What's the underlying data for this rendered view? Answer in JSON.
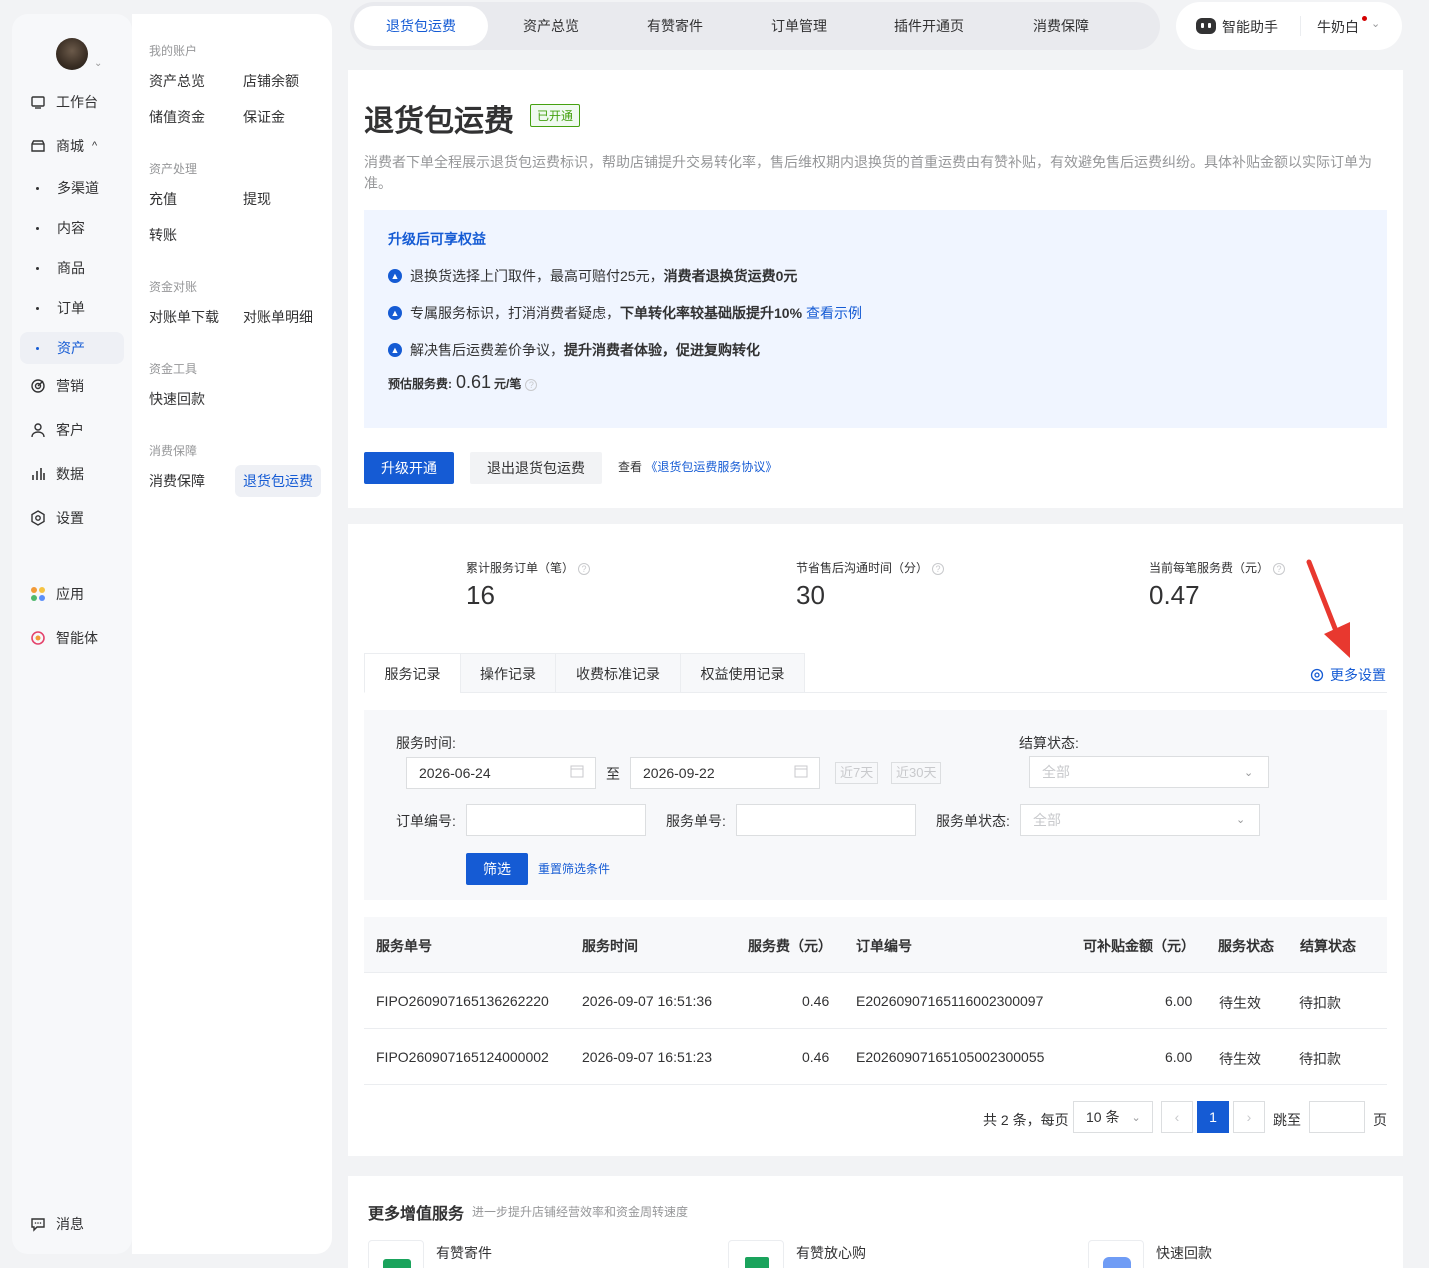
{
  "sidebar": {
    "main": [
      {
        "label": "工作台",
        "icon": "workbench-icon"
      },
      {
        "label": "商城",
        "icon": "store-icon",
        "chevron": "^"
      },
      {
        "label": "营销",
        "icon": "marketing-icon"
      },
      {
        "label": "客户",
        "icon": "customer-icon"
      },
      {
        "label": "数据",
        "icon": "data-icon"
      },
      {
        "label": "设置",
        "icon": "settings-icon"
      },
      {
        "label": "应用",
        "icon": "apps-icon"
      },
      {
        "label": "智能体",
        "icon": "agent-icon"
      }
    ],
    "mall_sub": [
      {
        "label": "多渠道"
      },
      {
        "label": "内容"
      },
      {
        "label": "商品"
      },
      {
        "label": "订单"
      },
      {
        "label": "资产",
        "active": true
      }
    ],
    "message": {
      "label": "消息",
      "icon": "message-icon"
    }
  },
  "subnav": {
    "groups": [
      {
        "title": "我的账户",
        "links": [
          "资产总览",
          "店铺余额",
          "储值资金",
          "保证金"
        ]
      },
      {
        "title": "资产处理",
        "links": [
          "充值",
          "提现",
          "转账"
        ]
      },
      {
        "title": "资金对账",
        "links": [
          "对账单下载",
          "对账单明细"
        ]
      },
      {
        "title": "资金工具",
        "links": [
          "快速回款"
        ]
      },
      {
        "title": "消费保障",
        "links": [
          "消费保障",
          "退货包运费"
        ]
      }
    ],
    "active_link": "退货包运费"
  },
  "topbar": {
    "tabs": [
      "退货包运费",
      "资产总览",
      "有赞寄件",
      "订单管理",
      "插件开通页",
      "消费保障"
    ],
    "active_tab": "退货包运费",
    "assistant": "智能助手",
    "user": "牛奶白"
  },
  "intro": {
    "title": "退货包运费",
    "status_badge": "已开通",
    "description": "消费者下单全程展示退货包运费标识，帮助店铺提升交易转化率，售后维权期内退换货的首重运费由有赞补贴，有效避免售后运费纠纷。具体补贴金额以实际订单为准。",
    "benefits_title": "升级后可享权益",
    "benefits": [
      {
        "text": "退换货选择上门取件，最高可赔付25元，",
        "bold": "消费者退换货运费0元",
        "link": ""
      },
      {
        "text": "专属服务标识，打消消费者疑虑，",
        "bold": "下单转化率较基础版提升10%",
        "link": "查看示例"
      },
      {
        "text": "解决售后运费差价争议，",
        "bold": "提升消费者体验，促进复购转化",
        "link": ""
      }
    ],
    "fee_label": "预估服务费:",
    "fee_value": "0.61",
    "fee_unit": "元/笔",
    "upgrade_button": "升级开通",
    "exit_button": "退出退货包运费",
    "agreement_prefix": "查看",
    "agreement_link": "《退货包运费服务协议》"
  },
  "stats": [
    {
      "label": "累计服务订单（笔）",
      "value": "16"
    },
    {
      "label": "节省售后沟通时间（分）",
      "value": "30"
    },
    {
      "label": "当前每笔服务费（元）",
      "value": "0.47"
    }
  ],
  "record_tabs": [
    "服务记录",
    "操作记录",
    "收费标准记录",
    "权益使用记录"
  ],
  "active_record_tab": "服务记录",
  "more_settings": "更多设置",
  "filter": {
    "service_time_label": "服务时间:",
    "start_date": "2026-06-24",
    "to_label": "至",
    "end_date": "2026-09-22",
    "quick_7": "近7天",
    "quick_30": "近30天",
    "settle_status_label": "结算状态:",
    "settle_status_value": "全部",
    "order_no_label": "订单编号:",
    "order_no_value": "",
    "service_no_label": "服务单号:",
    "service_no_value": "",
    "service_status_label": "服务单状态:",
    "service_status_value": "全部",
    "filter_button": "筛选",
    "reset_link": "重置筛选条件"
  },
  "table": {
    "headers": [
      "服务单号",
      "服务时间",
      "服务费（元）",
      "订单编号",
      "可补贴金额（元）",
      "服务状态",
      "结算状态"
    ],
    "rows": [
      [
        "FIPO260907165136262220",
        "2026-09-07 16:51:36",
        "0.46",
        "E20260907165116002300097",
        "6.00",
        "待生效",
        "待扣款"
      ],
      [
        "FIPO260907165124000002",
        "2026-09-07 16:51:23",
        "0.46",
        "E20260907165105002300055",
        "6.00",
        "待生效",
        "待扣款"
      ]
    ]
  },
  "pagination": {
    "total_text": "共 2 条，每页",
    "page_size": "10 条",
    "current_page": "1",
    "jump_label": "跳至",
    "page_suffix": "页"
  },
  "more_services": {
    "title": "更多增值服务",
    "subtitle": "进一步提升店铺经营效率和资金周转速度",
    "items": [
      "有赞寄件",
      "有赞放心购",
      "快速回款"
    ]
  },
  "colors": {
    "primary": "#155bd4",
    "success": "#45a110",
    "arrow": "#e8382f"
  }
}
